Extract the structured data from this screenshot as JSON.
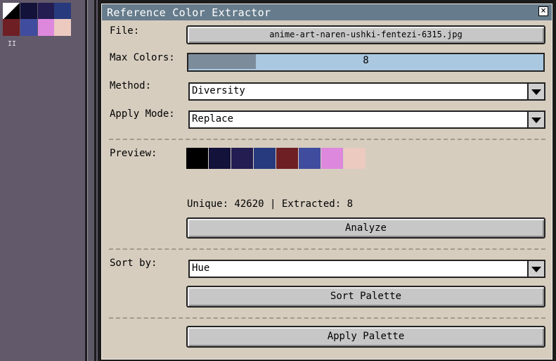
{
  "palette_strip": {
    "swatches": [
      {
        "color": "#000000"
      },
      {
        "color": "#12123a"
      },
      {
        "color": "#241d52"
      },
      {
        "color": "#283a7e"
      },
      {
        "color": "#6e1f24"
      },
      {
        "color": "#404c9e"
      },
      {
        "color": "#dd88dd"
      },
      {
        "color": "#eccac0"
      }
    ],
    "mark": "II"
  },
  "dialog": {
    "title": "Reference Color Extractor",
    "close_glyph": "×",
    "file": {
      "label": "File:",
      "value": "anime-art-naren-ushki-fentezi-6315.jpg"
    },
    "max_colors": {
      "label": "Max Colors:",
      "value": "8",
      "fill_fraction": 0.19
    },
    "method": {
      "label": "Method:",
      "value": "Diversity"
    },
    "apply_mode": {
      "label": "Apply Mode:",
      "value": "Replace"
    },
    "preview": {
      "label": "Preview:",
      "colors": [
        "#000000",
        "#12123a",
        "#241d52",
        "#283a7e",
        "#6e1f24",
        "#404c9e",
        "#dd88dd",
        "#eccac0"
      ]
    },
    "stats": "Unique: 42620 | Extracted: 8",
    "analyze_label": "Analyze",
    "sort_by": {
      "label": "Sort by:",
      "value": "Hue"
    },
    "sort_palette_label": "Sort Palette",
    "apply_palette_label": "Apply Palette"
  }
}
